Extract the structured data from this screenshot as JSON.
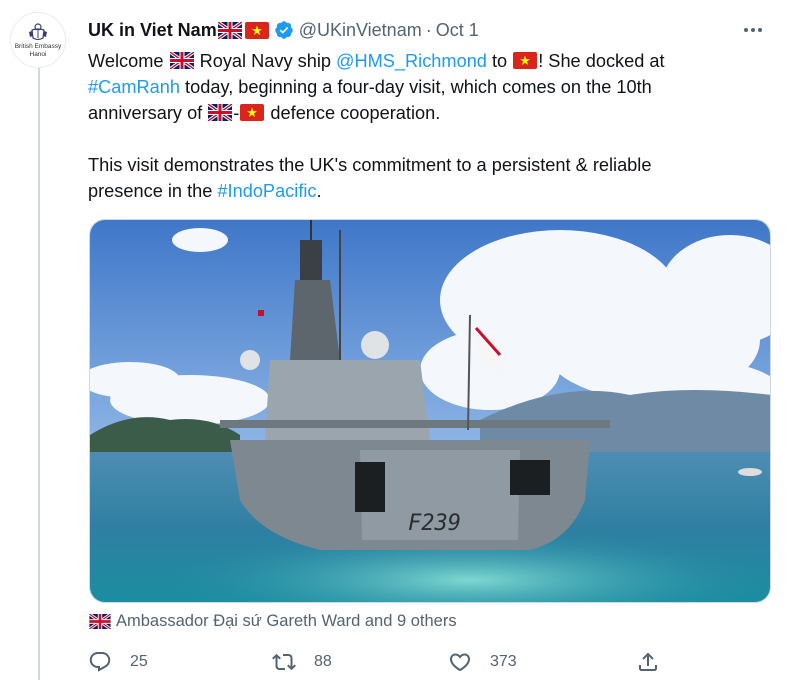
{
  "tweet": {
    "author": {
      "display_name": "UK in Viet Nam",
      "handle": "@UKinVietnam",
      "avatar_text_line1": "British Embassy",
      "avatar_text_line2": "Hanoi",
      "verified": true
    },
    "separator": "·",
    "date": "Oct 1",
    "text": {
      "welcome": "Welcome ",
      "royal_navy_ship": " Royal Navy ship ",
      "mention": "@HMS_Richmond",
      "to": " to ",
      "docked": "! She docked at",
      "hashtag_camranh": "#CamRanh",
      "today": " today, beginning a four-day visit, which comes on the 10th",
      "anniversary": "anniversary of ",
      "dash": "-",
      "defence": " defence cooperation.",
      "visit_line1": "This visit demonstrates the UK's commitment to a persistent & reliable",
      "visit_line2_pre": "presence in the ",
      "hashtag_indopacific": "#IndoPacific",
      "period": "."
    },
    "media": {
      "hull_number": "F239"
    },
    "liked_by": "Ambassador Đại sứ Gareth Ward and 9 others",
    "actions": {
      "replies": "25",
      "retweets": "88",
      "likes": "373"
    }
  },
  "colors": {
    "link": "#1d9bf0",
    "verified": "#1d9bf0",
    "muted_text": "#536471",
    "thread_line": "#cfd9de"
  },
  "icons": {
    "more": "more-dots-icon",
    "reply": "reply-icon",
    "retweet": "retweet-icon",
    "like": "heart-icon",
    "share": "share-icon",
    "uk_flag": "uk-flag-icon",
    "vn_flag": "vietnam-flag-icon"
  }
}
